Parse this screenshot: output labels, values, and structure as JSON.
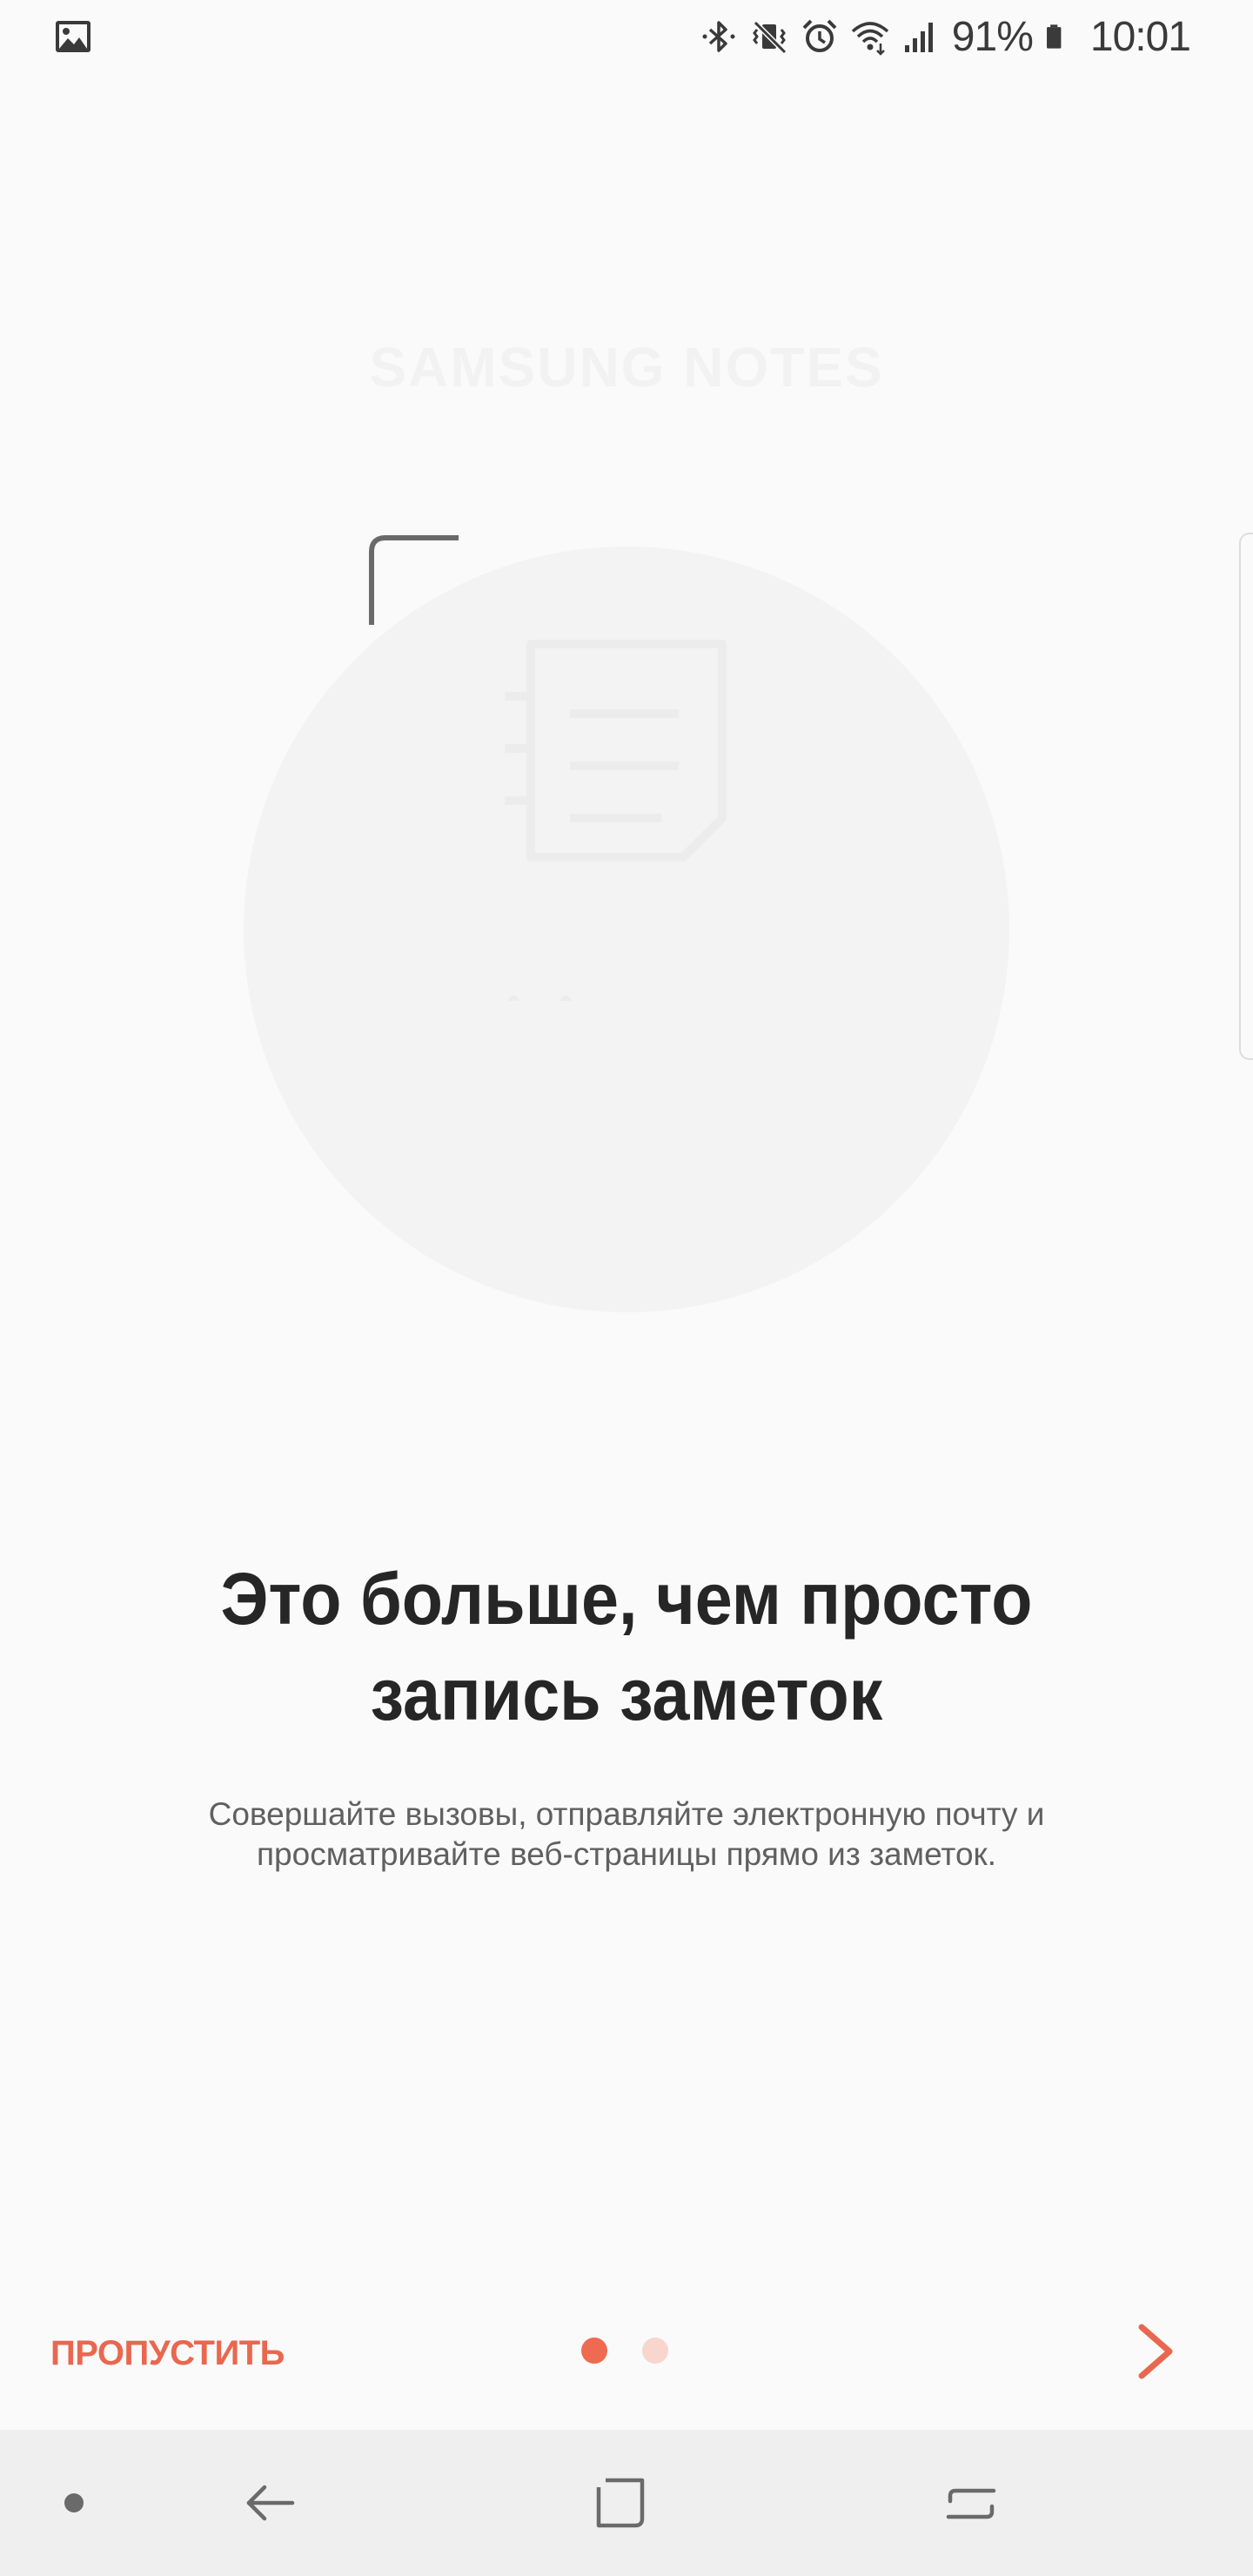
{
  "status_bar": {
    "notification_icon": "image-icon",
    "icons": [
      "bluetooth-icon",
      "vibrate-mute-icon",
      "alarm-icon",
      "wifi-icon",
      "signal-icon",
      "battery-icon"
    ],
    "battery_percent": "91%",
    "time": "10:01"
  },
  "app": {
    "brand_name": "SAMSUNG NOTES"
  },
  "onboarding": {
    "headline": "Это больше, чем просто запись заметок",
    "description": "Совершайте вызовы, отправляйте электронную почту и просматривайте веб-страницы прямо из заметок."
  },
  "controls": {
    "skip_label": "ПРОПУСТИТЬ",
    "page_count": 2,
    "current_page": 1,
    "next_icon": "chevron-right-icon"
  },
  "nav_bar": {
    "items": [
      "dot-icon",
      "back-icon",
      "home-icon",
      "recents-icon"
    ]
  },
  "colors": {
    "accent": "#ee6a51",
    "accent_light": "#f8d6cd",
    "background": "#fafafa",
    "nav_background": "#efefef"
  }
}
